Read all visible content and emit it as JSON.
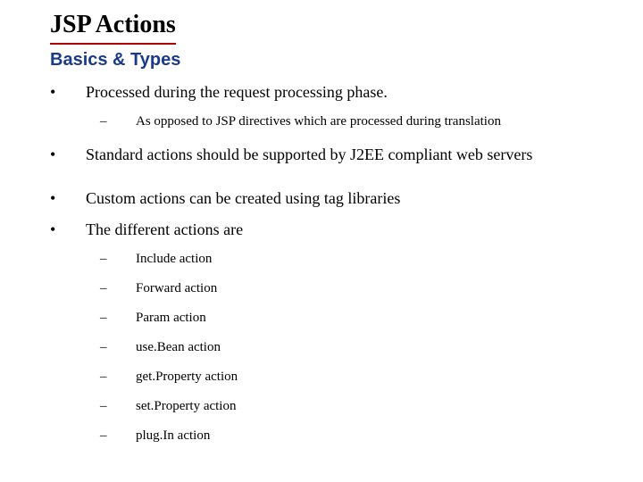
{
  "title": "JSP Actions",
  "subtitle": "Basics & Types",
  "items": [
    {
      "text": "Processed during the request processing phase.",
      "sub": [
        "As opposed to JSP directives which are processed during translation"
      ]
    },
    {
      "text": "Standard actions should be supported by J2EE compliant web servers",
      "sub": []
    },
    {
      "text": "Custom actions can be created using tag libraries",
      "sub": []
    },
    {
      "text": "The different actions are",
      "sub": [
        "Include action",
        "Forward action",
        "Param action",
        "use.Bean action",
        "get.Property action",
        "set.Property action",
        "plug.In action"
      ]
    }
  ]
}
